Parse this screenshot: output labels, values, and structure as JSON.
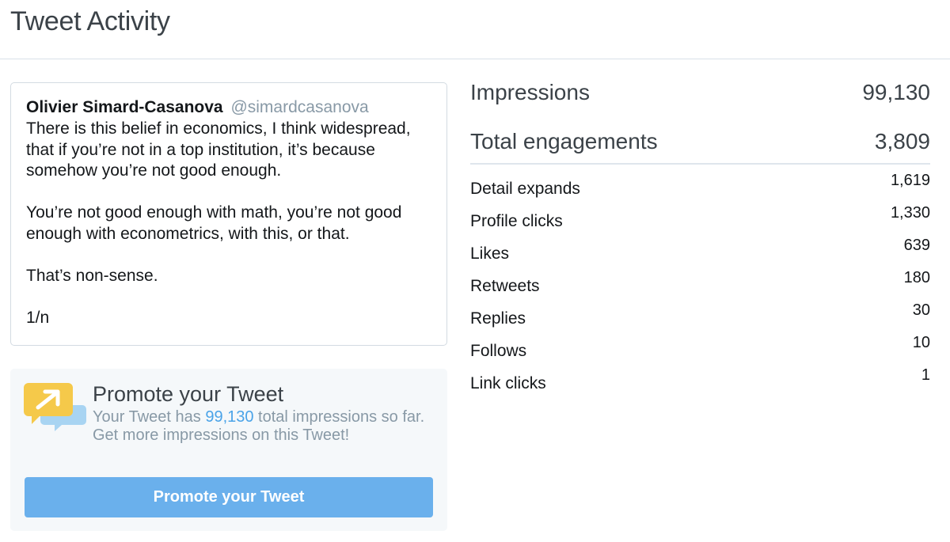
{
  "header": {
    "title": "Tweet Activity"
  },
  "tweet": {
    "author_name": "Olivier Simard-Casanova",
    "author_handle": "@simardcasanova",
    "paragraphs": [
      "There is this belief in economics, I think widespread, that if you’re not in a top institution, it’s because somehow you’re not good enough.",
      "You’re not good enough with math, you’re not good enough with econometrics, with this, or that.",
      "That’s non-sense.",
      "1/n"
    ]
  },
  "promote": {
    "title": "Promote your Tweet",
    "text_before": "Your Tweet has ",
    "impressions": "99,130",
    "text_after": " total impressions so far.",
    "cta_text": "Get more impressions on this Tweet!",
    "button_label": "Promote your Tweet",
    "icon": "promote-chat-bubble-arrow-icon"
  },
  "metrics": {
    "impressions_label": "Impressions",
    "impressions_value": "99,130",
    "engagements_label": "Total engagements",
    "engagements_value": "3,809",
    "details": [
      {
        "label": "Detail expands",
        "value": "1,619"
      },
      {
        "label": "Profile clicks",
        "value": "1,330"
      },
      {
        "label": "Likes",
        "value": "639"
      },
      {
        "label": "Retweets",
        "value": "180"
      },
      {
        "label": "Replies",
        "value": "30"
      },
      {
        "label": "Follows",
        "value": "10"
      },
      {
        "label": "Link clicks",
        "value": "1"
      }
    ]
  },
  "colors": {
    "accent": "#6ab0ec",
    "highlight": "#4aa3e8",
    "muted_text": "#8899a6",
    "icon_yellow": "#f5c94a",
    "icon_blue": "#a8d4f2"
  }
}
